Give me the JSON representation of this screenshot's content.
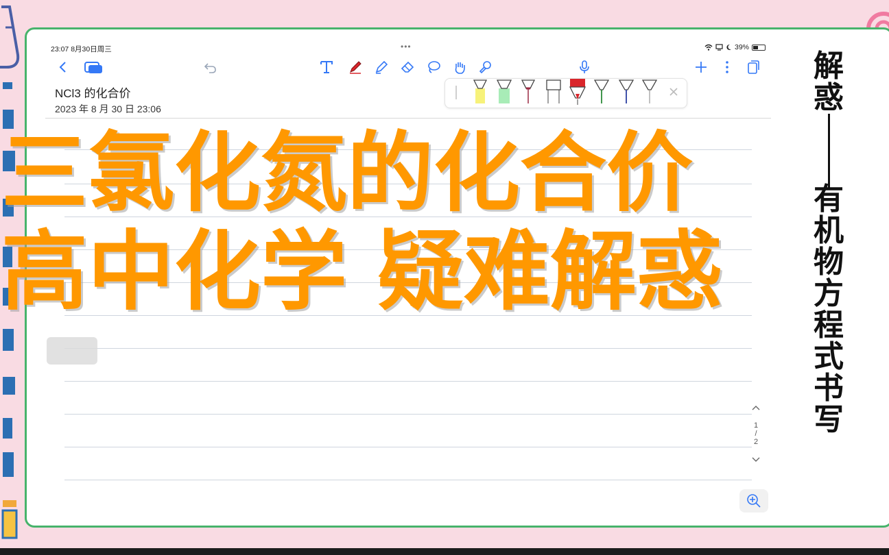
{
  "status_bar": {
    "time_date": "23:07  8月30日周三",
    "dots": "•••",
    "battery": "39%"
  },
  "note": {
    "title": "NCl3 的化合价",
    "date": "2023 年 8 月 30 日 23:06"
  },
  "overlay": {
    "line1": "三氯化氮的化合价",
    "line2": "高中化学 疑难解惑"
  },
  "side_title": {
    "top": [
      "解",
      "惑"
    ],
    "bottom": [
      "有",
      "机",
      "物",
      "方",
      "程",
      "式",
      "书",
      "写"
    ]
  },
  "pager": {
    "current": "1",
    "separator": "/",
    "total": "2"
  },
  "colors": {
    "overlay_orange": "#ff9800",
    "frame_green": "#47b36b",
    "background_pink": "#f9dbe3",
    "toolbar_blue": "#3478f6",
    "active_pen_red": "#d9262b"
  },
  "icons": {
    "toolbar": [
      "back-icon",
      "pages-icon",
      "undo-icon",
      "text-tool-icon",
      "pen-tool-icon",
      "highlighter-tool-icon",
      "eraser-tool-icon",
      "lasso-tool-icon",
      "hand-tool-icon",
      "shapes-tool-icon",
      "microphone-icon",
      "add-icon",
      "more-icon",
      "copy-icon"
    ],
    "pager": [
      "chevron-up-icon",
      "chevron-down-icon"
    ],
    "zoom": "zoom-in-icon"
  }
}
